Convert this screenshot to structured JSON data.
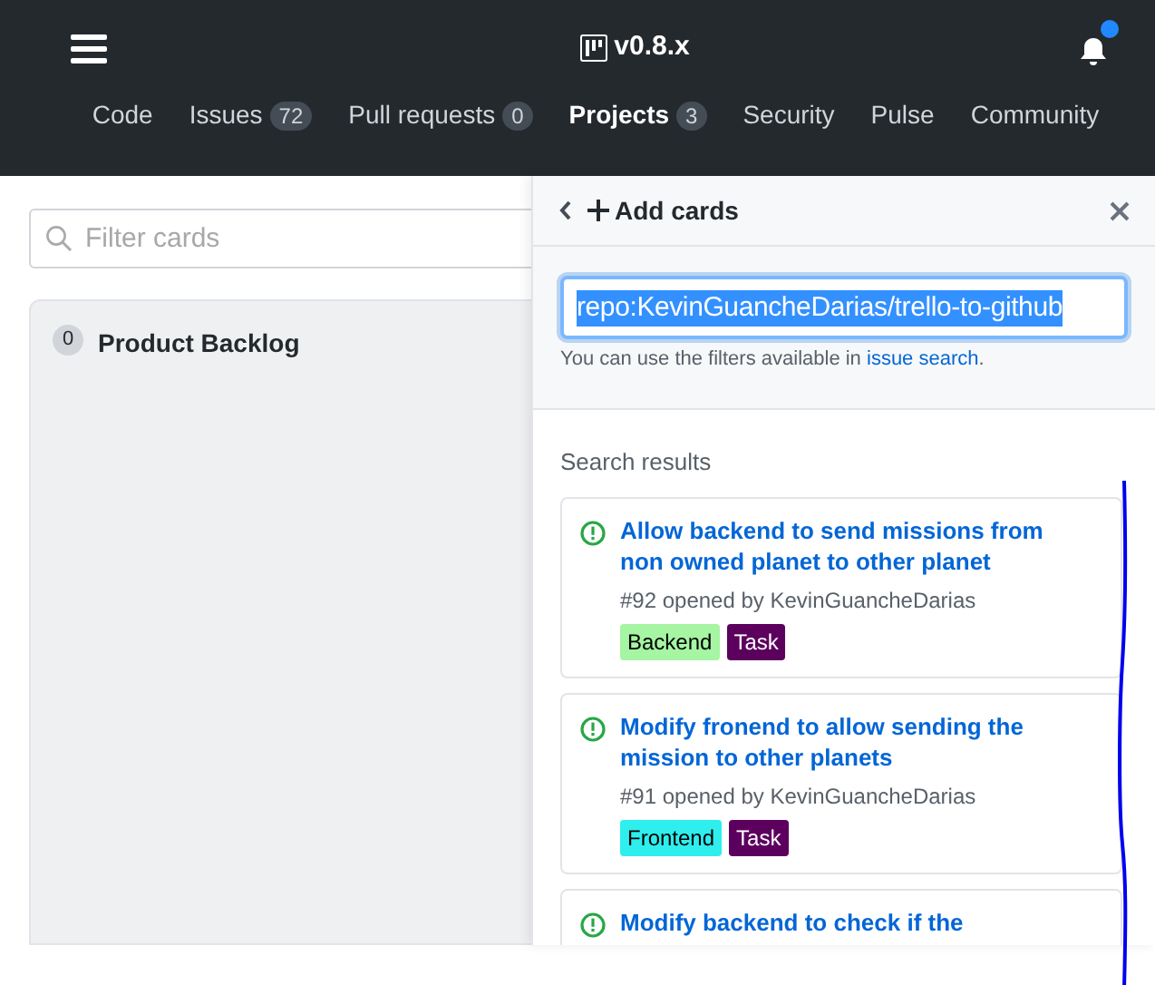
{
  "header": {
    "title": "v0.8.x",
    "notification": true
  },
  "nav": [
    {
      "label": "Code",
      "selected": false
    },
    {
      "label": "Issues",
      "count": "72",
      "selected": false
    },
    {
      "label": "Pull requests",
      "count": "0",
      "selected": false
    },
    {
      "label": "Projects",
      "count": "3",
      "selected": true
    },
    {
      "label": "Security",
      "selected": false
    },
    {
      "label": "Pulse",
      "selected": false
    },
    {
      "label": "Community",
      "selected": false
    }
  ],
  "filter": {
    "placeholder": "Filter cards"
  },
  "columns": [
    {
      "count": "0",
      "name": "Product Backlog"
    }
  ],
  "panel": {
    "title": "Add cards",
    "search_value": "repo:KevinGuancheDarias/trello-to-github",
    "hint": "You can use the filters available in",
    "hint_link": "issue search",
    "hint_end": ".",
    "results_heading": "Search results",
    "results": [
      {
        "title": "Allow backend to send missions from non owned planet to other planet",
        "meta": "#92 opened by KevinGuancheDarias",
        "labels": [
          {
            "name": "Backend",
            "color": "#a5f5a2",
            "dark_text": true
          },
          {
            "name": "Task",
            "color": "#5c005e",
            "dark_text": false
          }
        ]
      },
      {
        "title": "Modify fronend to allow sending the mission to other planets",
        "meta": "#91 opened by KevinGuancheDarias",
        "labels": [
          {
            "name": "Frontend",
            "color": "#2eeeee",
            "dark_text": true
          },
          {
            "name": "Task",
            "color": "#5c005e",
            "dark_text": false
          }
        ]
      },
      {
        "title": "Modify backend to check if the"
      }
    ]
  }
}
